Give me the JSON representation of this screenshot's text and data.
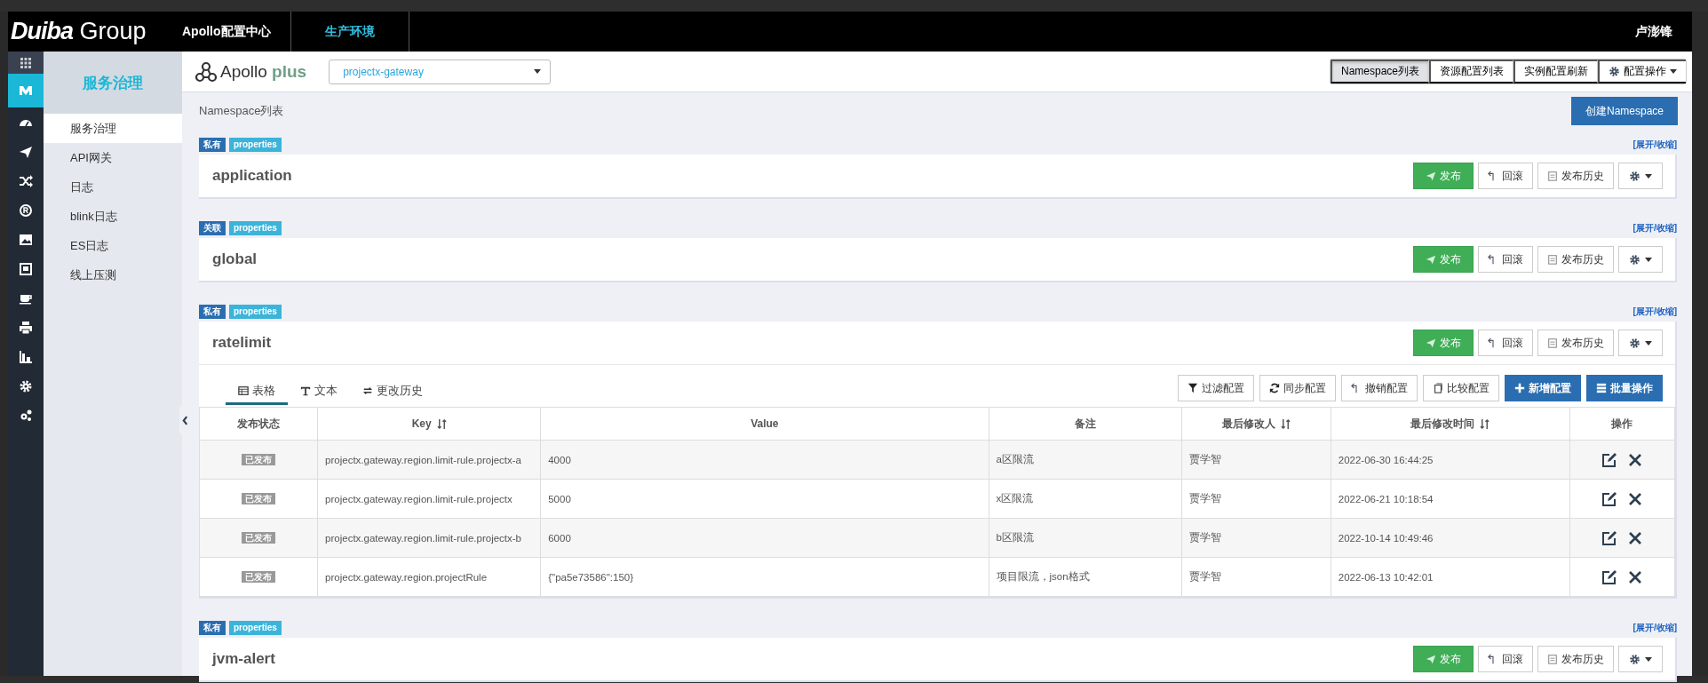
{
  "header": {
    "logo_bold": "Duiba",
    "logo_light": "Group",
    "app_title": "Apollo配置中心",
    "env": "生产环境",
    "user": "卢澎锋"
  },
  "rail": [
    {
      "kind": "apps",
      "selected": false
    },
    {
      "kind": "brand",
      "selected": true
    },
    {
      "kind": "dashboard",
      "selected": false
    },
    {
      "kind": "send",
      "selected": false
    },
    {
      "kind": "shuffle",
      "selected": false
    },
    {
      "kind": "registered",
      "selected": false
    },
    {
      "kind": "image",
      "selected": false
    },
    {
      "kind": "screen",
      "selected": false
    },
    {
      "kind": "cup",
      "selected": false
    },
    {
      "kind": "print",
      "selected": false
    },
    {
      "kind": "chart",
      "selected": false
    },
    {
      "kind": "gear",
      "selected": false
    },
    {
      "kind": "gears",
      "selected": false
    }
  ],
  "sidebar": {
    "title": "服务治理",
    "items": [
      {
        "label": "服务治理",
        "selected": true
      },
      {
        "label": "API网关",
        "selected": false
      },
      {
        "label": "日志",
        "selected": false
      },
      {
        "label": "blink日志",
        "selected": false
      },
      {
        "label": "ES日志",
        "selected": false
      },
      {
        "label": "线上压测",
        "selected": false
      }
    ]
  },
  "toolbar": {
    "logo_text": "Apollo",
    "logo_plus": "plus",
    "app_select": "projectx-gateway",
    "view_tabs": [
      {
        "label": "Namespace列表",
        "selected": true
      },
      {
        "label": "资源配置列表",
        "selected": false
      },
      {
        "label": "实例配置刷新",
        "selected": false
      }
    ],
    "ops_menu": "配置操作"
  },
  "list_title": "Namespace列表",
  "create_button": "创建Namespace",
  "namespaces": [
    {
      "scope": "私有",
      "format": "properties",
      "toggle": "[展开/收缩]",
      "name": "application",
      "expanded": false,
      "actions": [
        {
          "label": "发布",
          "kind": "publish"
        },
        {
          "label": "回滚",
          "kind": "rollback"
        },
        {
          "label": "发布历史",
          "kind": "history"
        }
      ]
    },
    {
      "scope": "关联",
      "format": "properties",
      "toggle": "[展开/收缩]",
      "name": "global",
      "expanded": false,
      "actions": [
        {
          "label": "发布",
          "kind": "publish"
        },
        {
          "label": "回滚",
          "kind": "rollback"
        },
        {
          "label": "发布历史",
          "kind": "history"
        }
      ]
    },
    {
      "scope": "私有",
      "format": "properties",
      "toggle": "[展开/收缩]",
      "name": "ratelimit",
      "expanded": true,
      "actions": [
        {
          "label": "发布",
          "kind": "publish"
        },
        {
          "label": "回滚",
          "kind": "rollback"
        },
        {
          "label": "发布历史",
          "kind": "history"
        }
      ],
      "tabs": [
        {
          "label": "表格",
          "kind": "table",
          "selected": true
        },
        {
          "label": "文本",
          "kind": "text",
          "selected": false
        },
        {
          "label": "更改历史",
          "kind": "history",
          "selected": false
        }
      ],
      "table_actions": [
        {
          "label": "过滤配置",
          "kind": "filter"
        },
        {
          "label": "同步配置",
          "kind": "sync"
        },
        {
          "label": "撤销配置",
          "kind": "revert"
        },
        {
          "label": "比较配置",
          "kind": "compare"
        },
        {
          "label": "新增配置",
          "kind": "add"
        },
        {
          "label": "批量操作",
          "kind": "batch"
        }
      ],
      "columns": [
        {
          "label": "发布状态",
          "sortable": false
        },
        {
          "label": "Key",
          "sortable": true
        },
        {
          "label": "Value",
          "sortable": false
        },
        {
          "label": "备注",
          "sortable": false
        },
        {
          "label": "最后修改人",
          "sortable": true
        },
        {
          "label": "最后修改时间",
          "sortable": true
        },
        {
          "label": "操作",
          "sortable": false
        }
      ],
      "rows": [
        {
          "status": "已发布",
          "key": "projectx.gateway.region.limit-rule.projectx-a",
          "value": "4000",
          "comment": "a区限流",
          "modifier": "贾学智",
          "time": "2022-06-30 16:44:25"
        },
        {
          "status": "已发布",
          "key": "projectx.gateway.region.limit-rule.projectx",
          "value": "5000",
          "comment": "x区限流",
          "modifier": "贾学智",
          "time": "2022-06-21 10:18:54"
        },
        {
          "status": "已发布",
          "key": "projectx.gateway.region.limit-rule.projectx-b",
          "value": "6000",
          "comment": "b区限流",
          "modifier": "贾学智",
          "time": "2022-10-14 10:49:46"
        },
        {
          "status": "已发布",
          "key": "projectx.gateway.region.projectRule",
          "value": "{\"pa5e73586\":150}",
          "comment": "项目限流，json格式",
          "modifier": "贾学智",
          "time": "2022-06-13 10:42:01"
        }
      ]
    },
    {
      "scope": "私有",
      "format": "properties",
      "toggle": "[展开/收缩]",
      "name": "jvm-alert",
      "expanded": false,
      "actions": [
        {
          "label": "发布",
          "kind": "publish"
        },
        {
          "label": "回滚",
          "kind": "rollback"
        },
        {
          "label": "发布历史",
          "kind": "history"
        }
      ]
    }
  ]
}
